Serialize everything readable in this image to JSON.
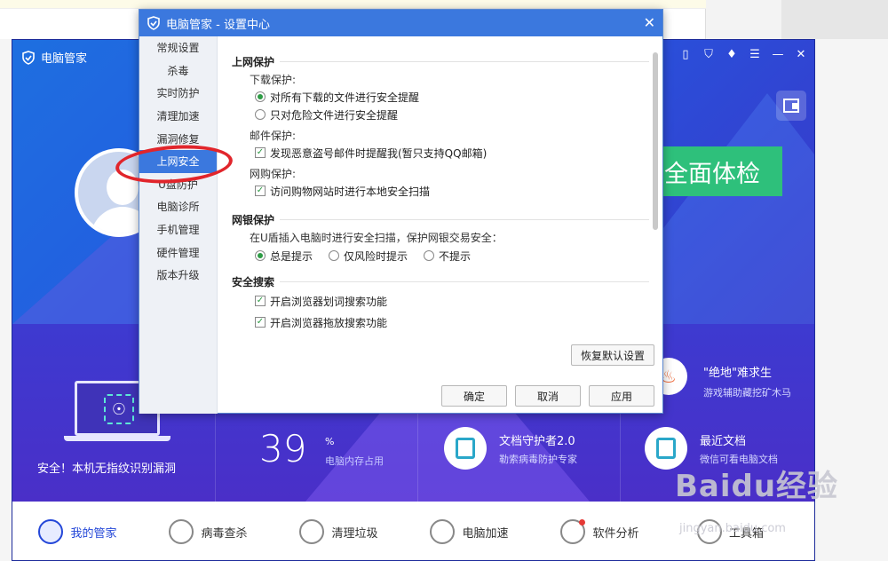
{
  "app": {
    "title": "电脑管家",
    "check_button": "全面体检",
    "safe_text": "安全！本机无指纹识别漏洞",
    "memory": {
      "value": "39",
      "unit": "%",
      "label": "电脑内存占用"
    },
    "cards": [
      {
        "title": "文档守护者2.0",
        "desc": "勒索病毒防护专家"
      },
      {
        "title": "最近文档",
        "desc": "微信可看电脑文档"
      }
    ],
    "promo": {
      "title": "\"绝地\"难求生",
      "desc": "游戏辅助藏挖矿木马"
    },
    "bottom_nav": [
      "我的管家",
      "病毒查杀",
      "清理垃圾",
      "电脑加速",
      "软件分析",
      "工具箱"
    ]
  },
  "dialog": {
    "title": "电脑管家 - 设置中心",
    "nav": [
      "常规设置",
      "杀毒",
      "实时防护",
      "清理加速",
      "漏洞修复",
      "上网安全",
      "U盘防护",
      "电脑诊所",
      "手机管理",
      "硬件管理",
      "版本升级"
    ],
    "sections": {
      "web_protect": "上网保护",
      "download_protect": "下载保护:",
      "download_opt1": "对所有下载的文件进行安全提醒",
      "download_opt2": "只对危险文件进行安全提醒",
      "mail_protect": "邮件保护:",
      "mail_opt": "发现恶意盗号邮件时提醒我(暂只支持QQ邮箱)",
      "shop_protect": "网购保护:",
      "shop_opt": "访问购物网站时进行本地安全扫描",
      "bank_protect": "网银保护",
      "bank_desc": "在U盾插入电脑时进行安全扫描，保护网银交易安全：",
      "bank_opt1": "总是提示",
      "bank_opt2": "仅风险时提示",
      "bank_opt3": "不提示",
      "safe_search": "安全搜索",
      "search_opt1": "开启浏览器划词搜索功能",
      "search_opt2": "开启浏览器拖放搜索功能"
    },
    "buttons": {
      "restore": "恢复默认设置",
      "ok": "确定",
      "cancel": "取消",
      "apply": "应用"
    }
  },
  "watermark": {
    "brand": "Baidu经验",
    "url": "jingyan.baidu.com"
  }
}
